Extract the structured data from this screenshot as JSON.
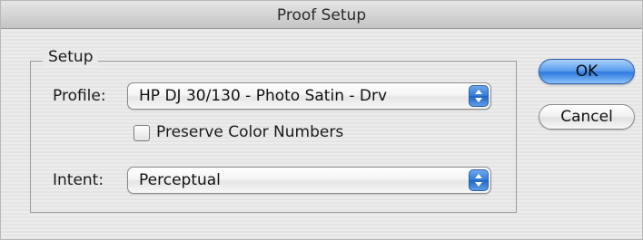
{
  "window": {
    "title": "Proof Setup"
  },
  "setup_group": {
    "legend": "Setup",
    "profile": {
      "label": "Profile:",
      "value": "HP DJ 30/130 - Photo Satin - Drv"
    },
    "preserve_color_numbers": {
      "label": "Preserve Color Numbers",
      "checked": false
    },
    "intent": {
      "label": "Intent:",
      "value": "Perceptual"
    }
  },
  "buttons": {
    "ok_label": "OK",
    "cancel_label": "Cancel"
  },
  "icons": {
    "popup_arrows": "up-down-arrows-icon"
  },
  "colors": {
    "default_button": "#3b86e4",
    "popup_arrows": "#2f79d8"
  }
}
